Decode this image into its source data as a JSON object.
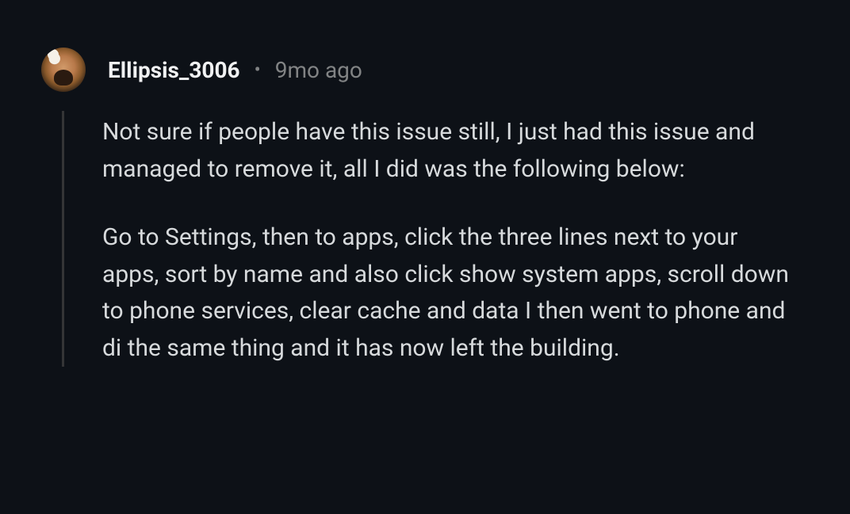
{
  "comment": {
    "author": "Ellipsis_3006",
    "timestamp": "9mo ago",
    "separator": "•",
    "paragraphs": {
      "p1": "Not sure if people have this issue still, I just had this issue and managed to remove it, all I did was the following below:",
      "p2": "Go to Settings, then to apps, click the three lines next to your apps, sort by name and also click show system apps, scroll down to phone services, clear cache and data I then went to phone and di the same thing and it has now left the building."
    }
  }
}
